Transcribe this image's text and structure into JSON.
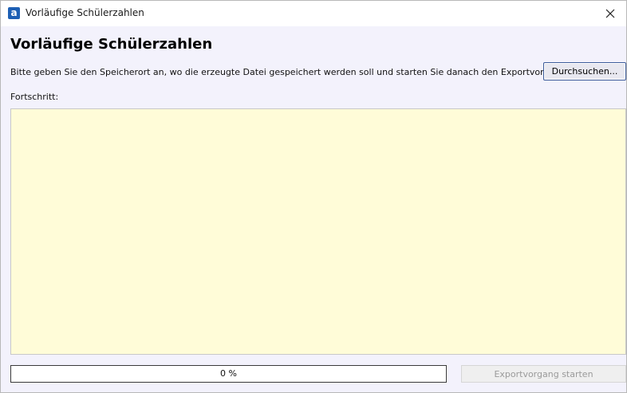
{
  "window": {
    "title": "Vorläufige Schülerzahlen",
    "app_icon_glyph": "a"
  },
  "content": {
    "heading": "Vorläufige Schülerzahlen",
    "instruction": "Bitte geben Sie den Speicherort an, wo die erzeugte Datei gespeichert werden soll und starten Sie danach den Exportvorgang.",
    "browse_label": "Durchsuchen...",
    "progress_label": "Fortschritt:",
    "log_text": ""
  },
  "footer": {
    "progress_value": 0,
    "progress_text": "0 %",
    "start_label": "Exportvorgang starten",
    "start_enabled": false
  },
  "colors": {
    "log_background": "#fffcd8",
    "window_background": "#f3f2fc",
    "app_icon": "#1d5fb4"
  }
}
